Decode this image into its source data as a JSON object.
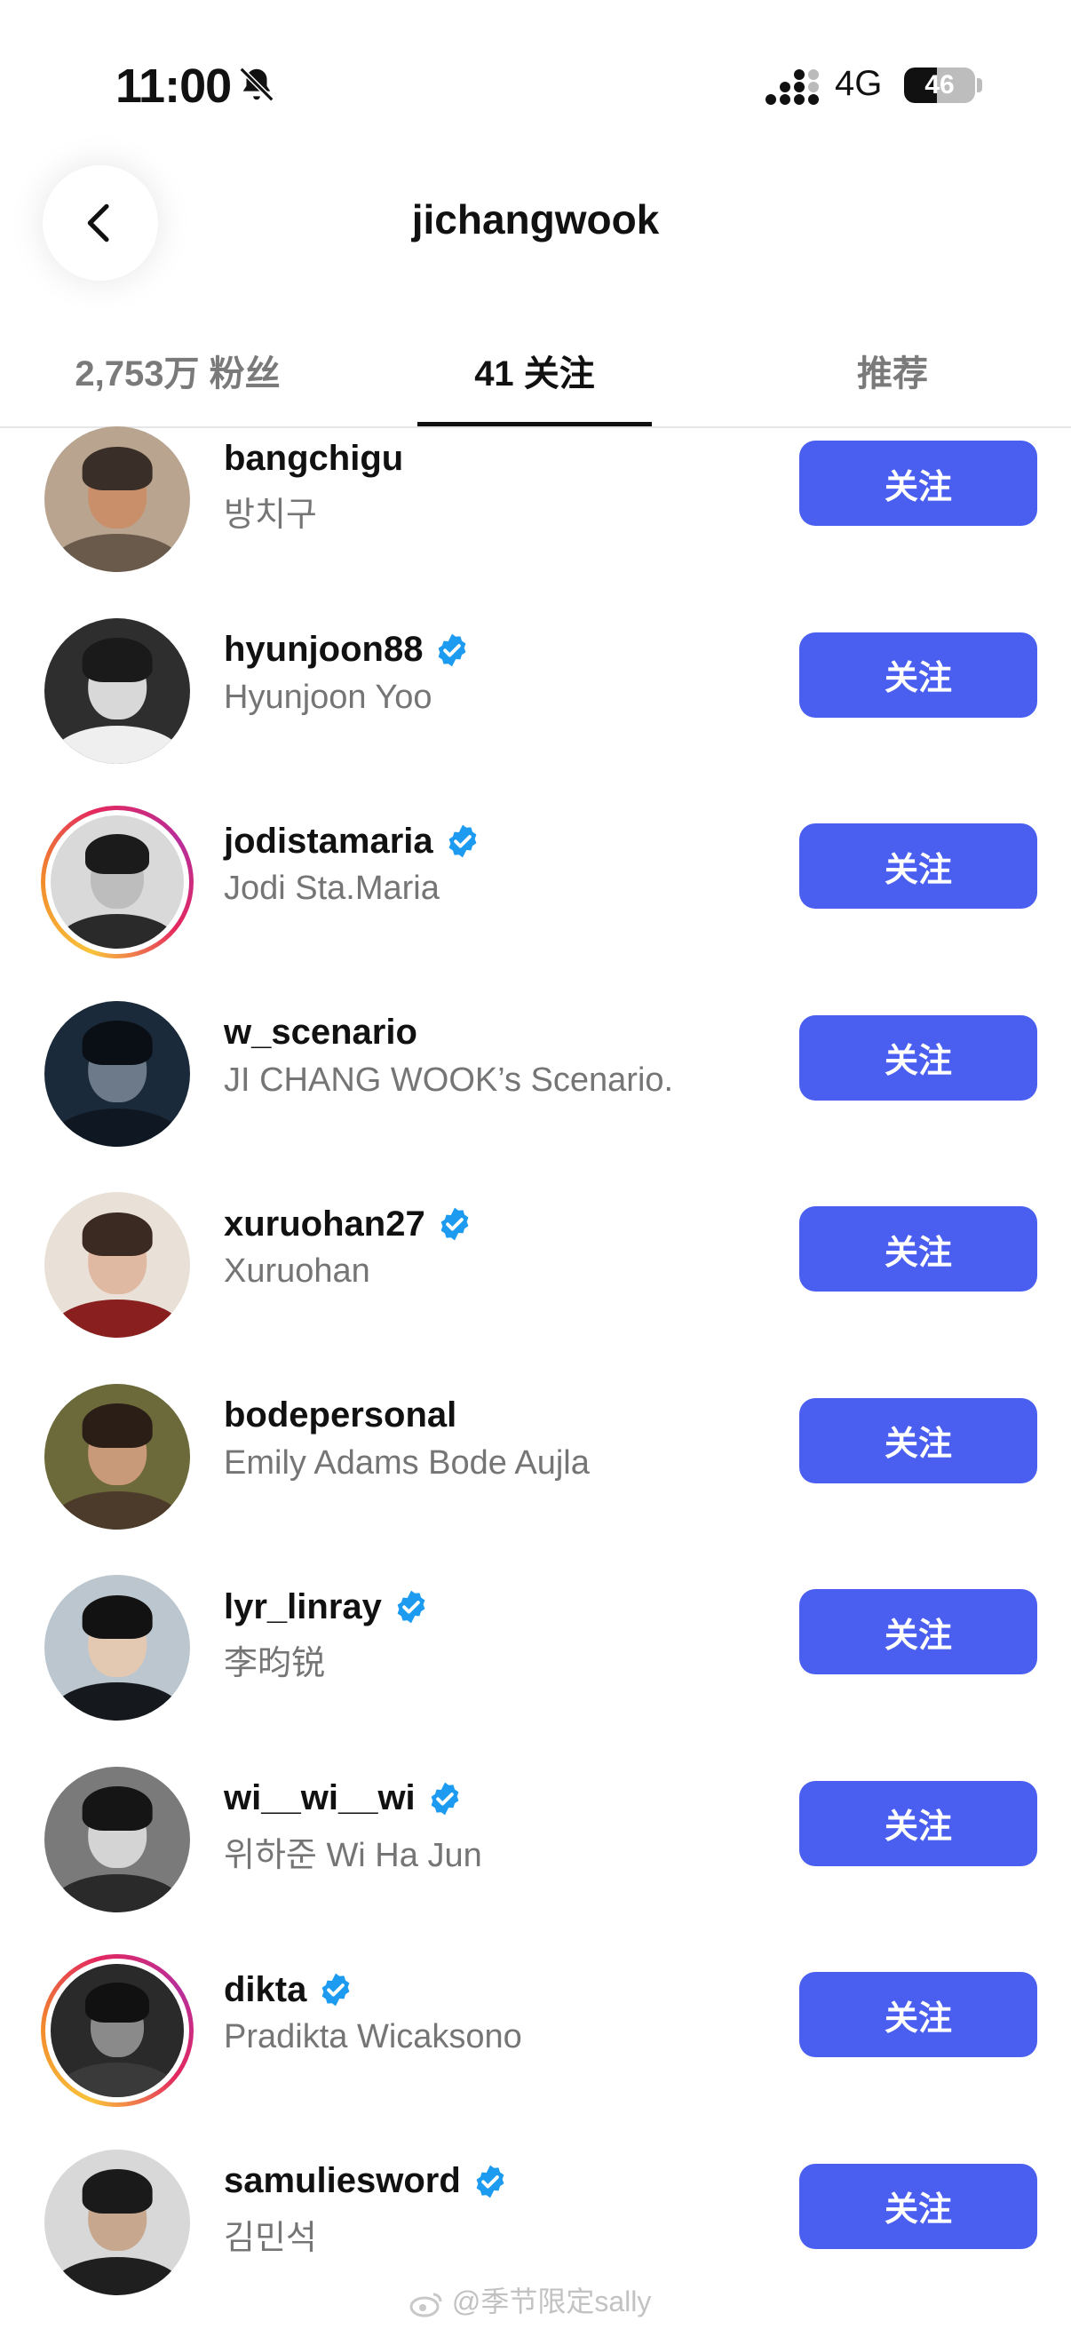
{
  "status_bar": {
    "time": "11:00",
    "network": "4G",
    "battery_percent": "46",
    "battery_level": 0.46
  },
  "header": {
    "title": "jichangwook",
    "back_icon": "chevron-left-icon"
  },
  "tabs": [
    {
      "label": "2,753万 粉丝",
      "active": false
    },
    {
      "label": "41 关注",
      "active": true
    },
    {
      "label": "推荐",
      "active": false
    }
  ],
  "follow_label": "关注",
  "following": [
    {
      "username": "bangchigu",
      "fullname": "방치구",
      "verified": false,
      "story_ring": false
    },
    {
      "username": "hyunjoon88",
      "fullname": "Hyunjoon Yoo",
      "verified": true,
      "story_ring": false
    },
    {
      "username": "jodistamaria",
      "fullname": "Jodi Sta.Maria",
      "verified": true,
      "story_ring": true
    },
    {
      "username": "w_scenario",
      "fullname": "JI CHANG WOOK’s Scenario.",
      "verified": false,
      "story_ring": false
    },
    {
      "username": "xuruohan27",
      "fullname": "Xuruohan",
      "verified": true,
      "story_ring": false
    },
    {
      "username": "bodepersonal",
      "fullname": "Emily Adams Bode Aujla",
      "verified": false,
      "story_ring": false
    },
    {
      "username": "lyr_linray",
      "fullname": "李昀锐",
      "verified": true,
      "story_ring": false
    },
    {
      "username": "wi__wi__wi",
      "fullname": "위하준 Wi Ha Jun",
      "verified": true,
      "story_ring": false
    },
    {
      "username": "dikta",
      "fullname": "Pradikta Wicaksono",
      "verified": true,
      "story_ring": true
    },
    {
      "username": "samuliesword",
      "fullname": "김민석",
      "verified": true,
      "story_ring": false
    }
  ],
  "watermark": "@季节限定sally",
  "colors": {
    "follow_button": "#4a5ff0",
    "verified_badge": "#1d9bf0",
    "secondary_text": "#757575"
  }
}
